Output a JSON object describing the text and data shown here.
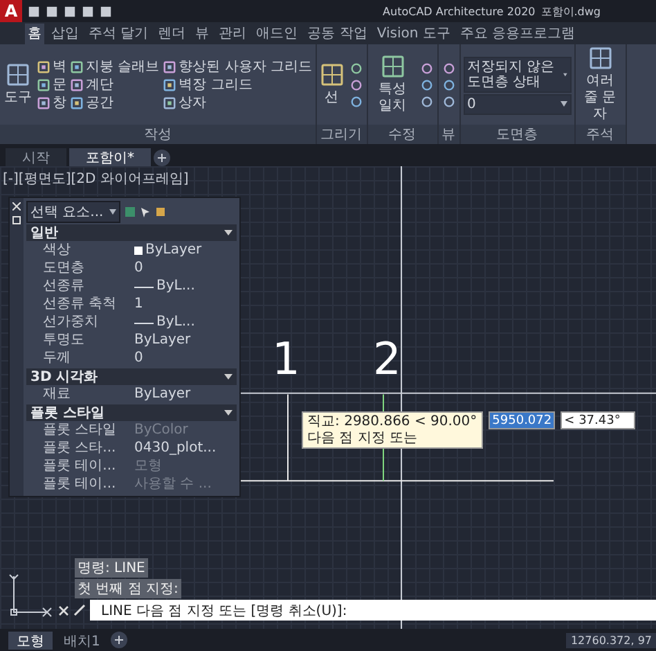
{
  "title_bar": {
    "app_button": "A",
    "app": "AutoCAD Architecture 2020",
    "file": "포함이.dwg"
  },
  "ribbon_tabs": [
    {
      "label": "홈",
      "selected": true
    },
    {
      "label": "삽입",
      "selected": false
    },
    {
      "label": "주석 달기",
      "selected": false
    },
    {
      "label": "렌더",
      "selected": false
    },
    {
      "label": "뷰",
      "selected": false
    },
    {
      "label": "관리",
      "selected": false
    },
    {
      "label": "애드인",
      "selected": false
    },
    {
      "label": "공동 작업",
      "selected": false
    },
    {
      "label": "Vision 도구",
      "selected": false
    },
    {
      "label": "주요 응용프로그램",
      "selected": false
    }
  ],
  "ribbon_panels": [
    {
      "title": "작성",
      "columns": [
        [
          {
            "kind": "large",
            "label": "도구"
          }
        ],
        [
          {
            "kind": "small",
            "label": "벽"
          },
          {
            "kind": "small",
            "label": "문"
          },
          {
            "kind": "small",
            "label": "창"
          }
        ],
        [
          {
            "kind": "small",
            "label": "지붕 슬래브"
          },
          {
            "kind": "small",
            "label": "계단"
          },
          {
            "kind": "small",
            "label": "공간"
          }
        ],
        [
          {
            "kind": "small",
            "label": "향상된 사용자 그리드"
          },
          {
            "kind": "small",
            "label": "벽장 그리드"
          },
          {
            "kind": "small",
            "label": "상자"
          }
        ]
      ]
    },
    {
      "title": "그리기",
      "columns": [
        [
          {
            "kind": "large",
            "label": "선"
          }
        ],
        [
          {
            "kind": "icon"
          },
          {
            "kind": "icon"
          },
          {
            "kind": "icon"
          }
        ]
      ]
    },
    {
      "title": "수정",
      "columns": [
        [
          {
            "kind": "large",
            "label": "특성 일치"
          }
        ],
        [
          {
            "kind": "icon"
          },
          {
            "kind": "icon"
          },
          {
            "kind": "icon"
          }
        ]
      ]
    },
    {
      "title": "뷰",
      "columns": [
        [
          {
            "kind": "icon"
          },
          {
            "kind": "icon"
          },
          {
            "kind": "icon"
          }
        ]
      ]
    },
    {
      "title": "도면층",
      "columns": [
        [
          {
            "kind": "combo",
            "label": "저장되지 않은 도면층 상태"
          },
          {
            "kind": "combo",
            "label": "0"
          }
        ]
      ]
    },
    {
      "title": "주석",
      "columns": [
        [
          {
            "kind": "large",
            "label": "여러 줄 문자"
          }
        ]
      ]
    }
  ],
  "file_tabs": [
    {
      "label": "시작",
      "selected": false
    },
    {
      "label": "포함이*",
      "selected": true
    }
  ],
  "viewport_label": "[-][평면도][2D 와이어프레임]",
  "drawing": {
    "labels": [
      "1",
      "2"
    ]
  },
  "tooltip": {
    "lines": [
      "직교: 2980.866 < 90.00°",
      "다음 점 지정 또는"
    ],
    "distance": "5950.072",
    "distance_selected": true,
    "angle": "< 37.43°"
  },
  "properties": {
    "selection": "선택 요소...",
    "sections": [
      {
        "title": "일반",
        "expanded": true,
        "rows": [
          {
            "name": "색상",
            "value": "ByLayer",
            "kind": "color",
            "disabled": false
          },
          {
            "name": "도면층",
            "value": "0",
            "kind": "text",
            "disabled": false
          },
          {
            "name": "선종류",
            "value": "ByL...",
            "kind": "line",
            "disabled": false
          },
          {
            "name": "선종류 축척",
            "value": "1",
            "kind": "text",
            "disabled": false
          },
          {
            "name": "선가중치",
            "value": "ByL...",
            "kind": "line",
            "disabled": false
          },
          {
            "name": "투명도",
            "value": "ByLayer",
            "kind": "text",
            "disabled": false
          },
          {
            "name": "두께",
            "value": "0",
            "kind": "text",
            "disabled": false
          }
        ]
      },
      {
        "title": "3D 시각화",
        "expanded": true,
        "rows": [
          {
            "name": "재료",
            "value": "ByLayer",
            "kind": "text",
            "disabled": false
          }
        ]
      },
      {
        "title": "플롯 스타일",
        "expanded": true,
        "rows": [
          {
            "name": "플롯 스타일",
            "value": "ByColor",
            "kind": "text",
            "disabled": true
          },
          {
            "name": "플롯 스타...",
            "value": "0430_plot...",
            "kind": "text",
            "disabled": false
          },
          {
            "name": "플롯 테이...",
            "value": "모형",
            "kind": "text",
            "disabled": true
          },
          {
            "name": "플롯 테이...",
            "value": "사용할 수 ...",
            "kind": "text",
            "disabled": true
          }
        ]
      }
    ]
  },
  "command_history": [
    "명령: LINE",
    "첫 번째 점 지정:"
  ],
  "command_prompt": "LINE 다음 점 지정 또는 [명령 취소(U)]:",
  "layout_tabs": [
    {
      "label": "모형",
      "selected": true
    },
    {
      "label": "배치1",
      "selected": false
    }
  ],
  "coordinates": "12760.372, 97"
}
